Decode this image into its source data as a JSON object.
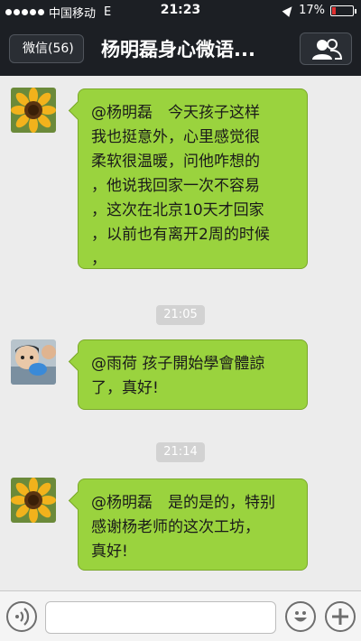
{
  "status_bar": {
    "carrier": "中国移动",
    "network": "E",
    "time": "21:23",
    "battery_percent_label": "17%",
    "battery_level": 0.17
  },
  "nav": {
    "back_label": "微信(56)",
    "title": "杨明磊身心微语..."
  },
  "messages": [
    {
      "sender_avatar": "sunflower-avatar",
      "text": "@杨明磊　今天孩子这样\n我也挺意外，心里感觉很\n柔软很温暖，问他咋想的\n，他说我回家一次不容易\n，这次在北京10天才回家\n，以前也有离开2周的时候\n，"
    },
    {
      "sender_avatar": "child-avatar",
      "text": "@雨荷 孩子開始學會體諒\n了，真好!"
    },
    {
      "sender_avatar": "sunflower-avatar",
      "text": "@杨明磊　是的是的，特别\n感谢杨老师的这次工坊，\n真好!"
    }
  ],
  "timestamps": [
    "21:05",
    "21:14"
  ],
  "input_bar": {
    "voice_icon": "voice-icon",
    "emoji_icon": "emoji-icon",
    "plus_icon": "plus-icon",
    "placeholder": ""
  },
  "colors": {
    "bubble": "#9ad33e",
    "background": "#ececec",
    "bar": "#1c1f24",
    "battery_low": "#e03030"
  }
}
